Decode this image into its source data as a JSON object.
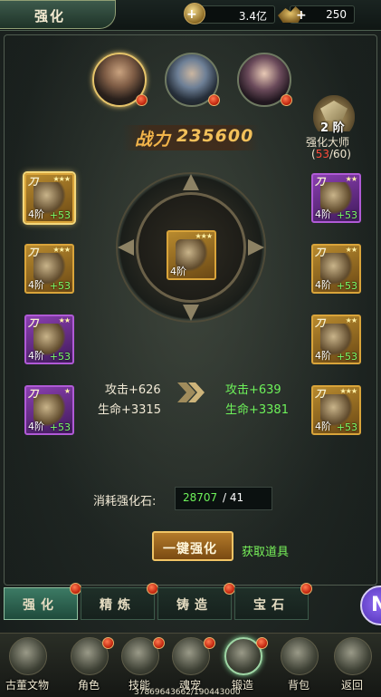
{
  "header": {
    "title": "强化",
    "silver_value": "3.4亿",
    "ingot_value": "250",
    "silver_icon": "coin-icon",
    "ingot_icon": "ingot-icon",
    "plus": "+"
  },
  "power": {
    "label": "战力",
    "value": "235600"
  },
  "master": {
    "rank": "2 阶",
    "label": "强化大师",
    "progress_open": "(",
    "progress_current": "53",
    "progress_rest": "/60)"
  },
  "slots": [
    {
      "cat": "刀",
      "stars": "★★★",
      "rank": "4阶",
      "bonus": "+53",
      "quality": "gold"
    },
    {
      "cat": "刀",
      "stars": "★★★",
      "rank": "4阶",
      "bonus": "+53",
      "quality": "gold"
    },
    {
      "cat": "刀",
      "stars": "★★",
      "rank": "4阶",
      "bonus": "+53",
      "quality": "purple"
    },
    {
      "cat": "刀",
      "stars": "★",
      "rank": "4阶",
      "bonus": "+53",
      "quality": "purple"
    },
    {
      "cat": "刀",
      "stars": "★★",
      "rank": "4阶",
      "bonus": "+53",
      "quality": "purple"
    },
    {
      "cat": "刀",
      "stars": "★★",
      "rank": "4阶",
      "bonus": "+53",
      "quality": "gold"
    },
    {
      "cat": "刀",
      "stars": "★★",
      "rank": "4阶",
      "bonus": "+53",
      "quality": "gold"
    },
    {
      "cat": "刀",
      "stars": "★★★",
      "rank": "4阶",
      "bonus": "+53",
      "quality": "gold"
    }
  ],
  "center_item": {
    "stars": "★★★",
    "rank": "4阶"
  },
  "stats": {
    "current_attack": "攻击+626",
    "current_hp": "生命+3315",
    "next_attack": "攻击+639",
    "next_hp": "生命+3381"
  },
  "cost": {
    "label": "消耗强化石:",
    "have": "28707",
    "need": " / 41"
  },
  "actions": {
    "one_key": "一键强化",
    "get_items": "获取道具"
  },
  "tabs": [
    {
      "label": "强化",
      "active": true
    },
    {
      "label": "精炼",
      "active": false
    },
    {
      "label": "铸造",
      "active": false
    },
    {
      "label": "宝石",
      "active": false
    }
  ],
  "side_bubble": "N",
  "bottom_nav": [
    {
      "label": "古董文物",
      "icon": "antique-icon"
    },
    {
      "label": "角色",
      "icon": "character-icon"
    },
    {
      "label": "技能",
      "icon": "skill-icon"
    },
    {
      "label": "魂宠",
      "icon": "pet-icon"
    },
    {
      "label": "锻造",
      "icon": "forge-icon"
    },
    {
      "label": "背包",
      "icon": "bag-icon"
    },
    {
      "label": "返回",
      "icon": "return-icon"
    }
  ],
  "footer_id": "37869643662/190443000",
  "colors": {
    "accent_gold": "#f2b44a",
    "bonus_green": "#7cff6a",
    "badge_red": "#c2260f",
    "tab_active": "#3c7a64"
  }
}
